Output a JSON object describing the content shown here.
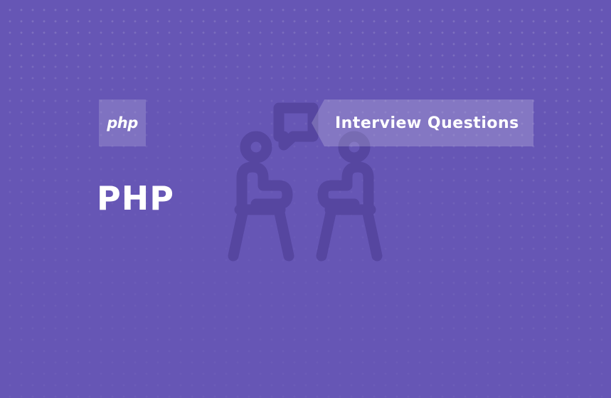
{
  "logo": {
    "text": "php"
  },
  "title": "PHP",
  "tag": {
    "label": "Interview Questions"
  },
  "colors": {
    "background": "#6656b5",
    "text": "#ffffff",
    "icon": "#5646a0"
  },
  "icons": {
    "decorative": "interview-people-icon"
  }
}
